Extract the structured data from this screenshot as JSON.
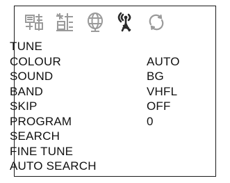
{
  "icons": [
    "picture-icon",
    "sound-icon",
    "globe-icon",
    "tuning-antenna-icon",
    "refresh-icon"
  ],
  "menu": {
    "items": [
      {
        "label": "TUNE",
        "value": ""
      },
      {
        "label": "COLOUR",
        "value": "AUTO"
      },
      {
        "label": "SOUND",
        "value": "BG"
      },
      {
        "label": "BAND",
        "value": "VHFL"
      },
      {
        "label": "SKIP",
        "value": "OFF"
      },
      {
        "label": "PROGRAM",
        "value": "0"
      },
      {
        "label": "SEARCH",
        "value": ""
      },
      {
        "label": "FINE TUNE",
        "value": ""
      },
      {
        "label": "AUTO SEARCH",
        "value": ""
      }
    ]
  },
  "colors": {
    "text": "#111111",
    "icon_gray": "#9a9a9a",
    "icon_dark": "#2a2a2a",
    "border": "#1a1a1a"
  }
}
